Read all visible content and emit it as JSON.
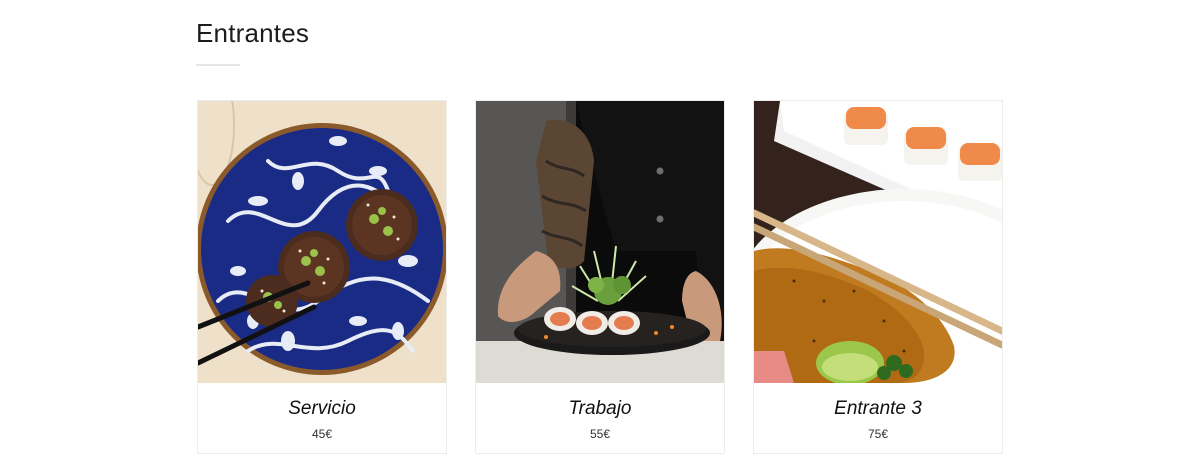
{
  "section": {
    "title": "Entrantes"
  },
  "items": [
    {
      "name": "Servicio",
      "price": "45€",
      "photo": "sushi-on-blue-plate-photo"
    },
    {
      "name": "Trabajo",
      "price": "55€",
      "photo": "chef-serving-sushi-roll-photo"
    },
    {
      "name": "Entrante 3",
      "price": "75€",
      "photo": "sushi-with-chopsticks-and-sauce-photo"
    }
  ]
}
